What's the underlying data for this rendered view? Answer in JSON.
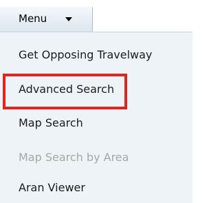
{
  "menu": {
    "label": "Menu",
    "caret_icon": "caret-down-icon",
    "items": [
      {
        "label": "Get Opposing Travelway",
        "enabled": true
      },
      {
        "label": "Advanced Search",
        "enabled": true
      },
      {
        "label": "Map Search",
        "enabled": true,
        "highlighted": true
      },
      {
        "label": "Map Search by Area",
        "enabled": false
      },
      {
        "label": "Aran Viewer",
        "enabled": true
      }
    ]
  },
  "colors": {
    "menu_tab_background": "#dde7ef",
    "dropdown_background": "#eef3f7",
    "text": "#1c1c1c",
    "disabled_text": "#a7a7a7",
    "highlight_border": "#e2241c"
  }
}
